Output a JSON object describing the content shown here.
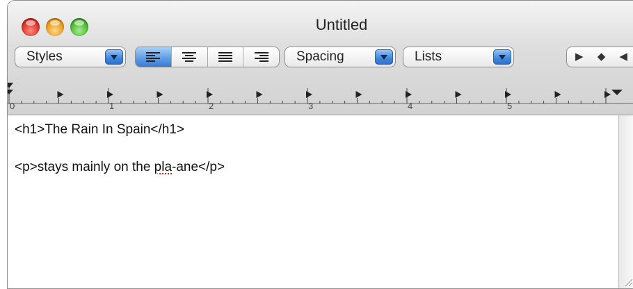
{
  "window": {
    "title": "Untitled"
  },
  "toolbar": {
    "styles_label": "Styles",
    "spacing_label": "Spacing",
    "lists_label": "Lists",
    "nav_glyphs": "▶ ◆ ◀"
  },
  "ruler": {
    "numbers": [
      "0",
      "1",
      "2",
      "3",
      "4",
      "5"
    ]
  },
  "document": {
    "line1": "<h1>The Rain In Spain</h1>",
    "line2_before": "<p>stays mainly on the ",
    "line2_misspelled": "pla",
    "line2_after": "-ane</p>"
  },
  "colors": {
    "selection_blue": "#3f86df",
    "spell_underline": "#e02020"
  }
}
